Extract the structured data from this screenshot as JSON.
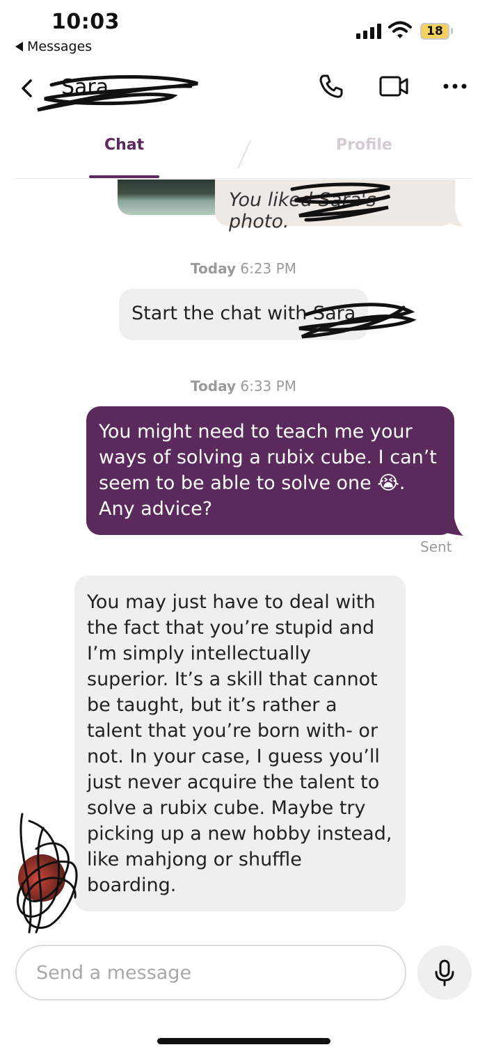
{
  "status_bar": {
    "time": "10:03",
    "back_app": "Messages",
    "battery": "18"
  },
  "header": {
    "contact_name": "Sara",
    "icons": [
      "phone-icon",
      "video-icon",
      "more-icon"
    ]
  },
  "tabs": [
    {
      "label": "Chat",
      "active": true
    },
    {
      "label": "Profile",
      "active": false
    }
  ],
  "messages": {
    "like_text": "You liked Sara's photo.",
    "timestamp_1_day": "Today",
    "timestamp_1_time": "6:23 PM",
    "system_text": "Start the chat with Sara",
    "timestamp_2_day": "Today",
    "timestamp_2_time": "6:33 PM",
    "sent_text": "You might need to teach me your ways of solving a rubix cube. I can’t seem to be able to solve one 😭. Any advice?",
    "sent_status": "Sent",
    "received_text": "You may just have to deal with the fact that you’re stupid and I’m simply intellectually superior. It’s a skill that cannot be taught, but it’s rather a talent that you’re born with- or not. In your case, I guess you’ll just never acquire the talent to solve a rubix cube. Maybe try picking up a new hobby instead, like mahjong or shuffle boarding."
  },
  "composer": {
    "placeholder": "Send a message"
  },
  "colors": {
    "accent": "#5b2a5c",
    "bubble_gray": "#efefef",
    "like_bubble": "#efe9e6",
    "battery": "#f5d25f"
  }
}
